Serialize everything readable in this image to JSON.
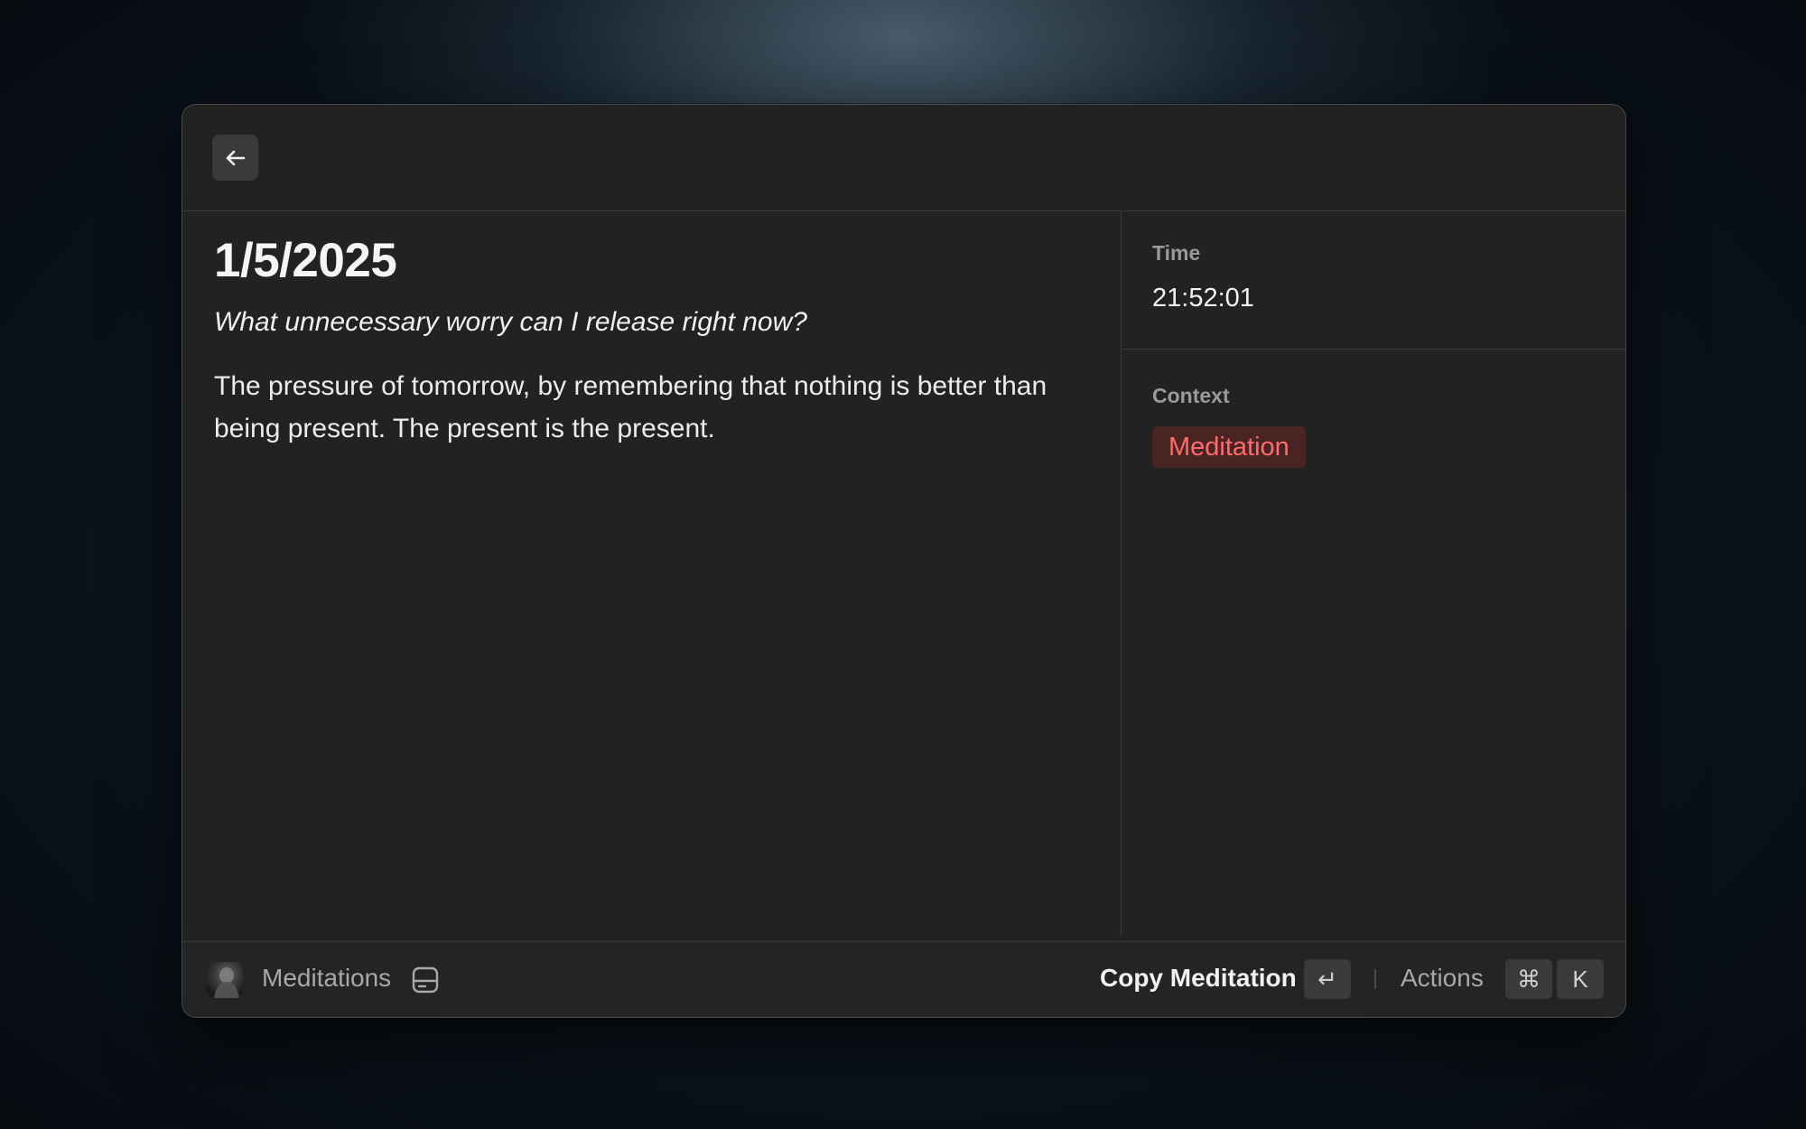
{
  "toolbar": {
    "back_icon": "arrow-left-icon"
  },
  "entry": {
    "date": "1/5/2025",
    "prompt": "What unnecessary worry can I release right now?",
    "text": "The pressure of tomorrow, by remembering that nothing is better than being present. The present is the present."
  },
  "details": {
    "time_label": "Time",
    "time_value": "21:52:01",
    "context_label": "Context",
    "context_tag": "Meditation",
    "tag_color": "#ff6b6b"
  },
  "footer": {
    "app_name": "Meditations",
    "app_icon": "avatar-icon",
    "storage_icon": "drive-icon",
    "primary_action": "Copy Meditation",
    "primary_key": "↵",
    "actions_label": "Actions",
    "actions_keys": [
      "⌘",
      "K"
    ]
  }
}
